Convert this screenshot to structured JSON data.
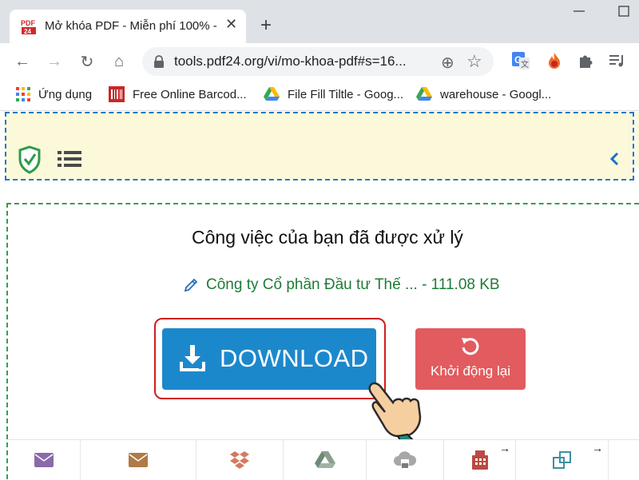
{
  "browser": {
    "tab_title": "Mở khóa PDF - Miễn phí 100% - ",
    "tab_close": "✕",
    "new_tab": "+",
    "url": "tools.pdf24.org/vi/mo-khoa-pdf#s=16...",
    "omni_add": "⊕",
    "omni_star": "☆",
    "back": "←",
    "forward": "→",
    "reload": "↻",
    "home": "⌂"
  },
  "bookmarks": [
    {
      "label": "Ứng dụng",
      "icon": "apps-grid-icon"
    },
    {
      "label": "Free Online Barcod...",
      "icon": "barcode-icon"
    },
    {
      "label": "File Fill Tiltle - Goog...",
      "icon": "google-drive-icon"
    },
    {
      "label": "warehouse - Googl...",
      "icon": "google-drive-icon"
    }
  ],
  "main": {
    "done_title": "Công việc của bạn đã được xử lý",
    "file_name": "Công ty Cổ phần Đầu tư Thế ... - 111.08 KB",
    "download_label": "DOWNLOAD",
    "restart_label": "Khởi động lại"
  },
  "colors": {
    "download": "#1c88cc",
    "restart": "#e25b5e",
    "file_text": "#1f7b37",
    "header_bg": "#fcf9da"
  },
  "bottom_tools": [
    {
      "icon": "email-icon"
    },
    {
      "icon": "envelope-icon"
    },
    {
      "icon": "dropbox-icon"
    },
    {
      "icon": "google-drive-icon"
    },
    {
      "icon": "cloud-print-icon"
    },
    {
      "icon": "fax-icon",
      "arrow": "→"
    },
    {
      "icon": "copy-icon",
      "arrow": "→"
    }
  ]
}
